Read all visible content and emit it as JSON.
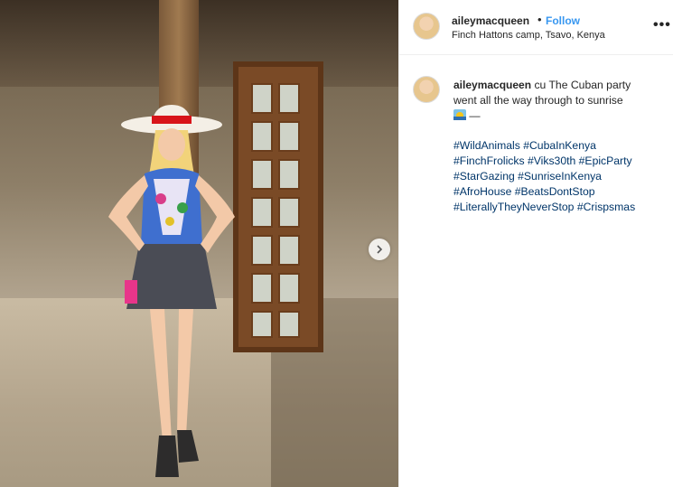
{
  "header": {
    "username": "aileymacqueen",
    "separator": "•",
    "follow_label": "Follow",
    "location": "Finch Hattons camp, Tsavo, Kenya",
    "more_label": "•••"
  },
  "caption": {
    "username": "aileymacqueen",
    "text": "cu The Cuban party went all the way through to sunrise",
    "trailing": "—",
    "emoji_icon": "sunrise-emoji-icon",
    "hashtags": [
      "#WildAnimals",
      "#CubaInKenya",
      "#FinchFrolicks",
      "#Viks30th",
      "#EpicParty",
      "#StarGazing",
      "#SunriseInKenya",
      "#AfroHouse",
      "#BeatsDontStop",
      "#LiterallyTheyNeverStop",
      "#Crispsmas"
    ]
  },
  "media": {
    "next_icon": "chevron-right-icon"
  },
  "colors": {
    "link": "#3897f0",
    "hashtag": "#003569",
    "text": "#262626",
    "divider": "#efefef"
  }
}
